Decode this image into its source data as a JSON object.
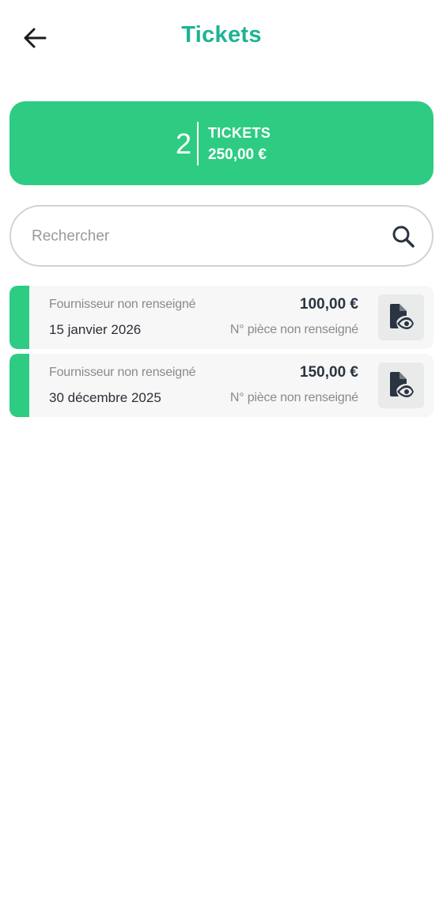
{
  "header": {
    "title": "Tickets",
    "back_icon": "arrow-left-icon"
  },
  "summary": {
    "count": "2",
    "label": "TICKETS",
    "total": "250,00 €"
  },
  "search": {
    "placeholder": "Rechercher",
    "value": "",
    "icon": "search-icon"
  },
  "tickets": [
    {
      "supplier": "Fournisseur non renseigné",
      "date": "15 janvier 2026",
      "amount": "100,00 €",
      "piece": "N° pièce non renseigné",
      "view_icon": "document-view-icon"
    },
    {
      "supplier": "Fournisseur non renseigné",
      "date": "30 décembre 2025",
      "amount": "150,00 €",
      "piece": "N° pièce non renseigné",
      "view_icon": "document-view-icon"
    }
  ],
  "colors": {
    "accent": "#2ecc82",
    "title": "#1db394",
    "text_dark": "#2b3442",
    "text_muted": "#8a8a8a"
  }
}
